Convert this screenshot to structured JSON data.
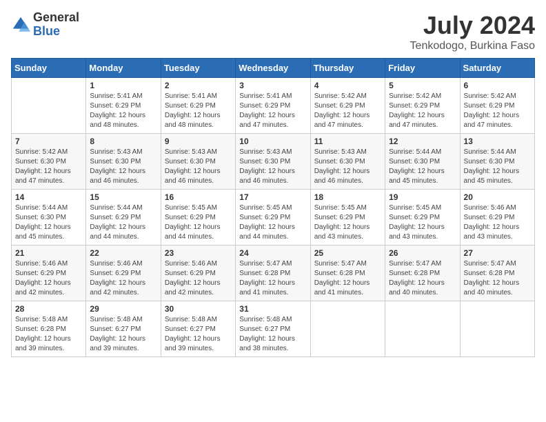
{
  "header": {
    "logo_general": "General",
    "logo_blue": "Blue",
    "title": "July 2024",
    "subtitle": "Tenkodogo, Burkina Faso"
  },
  "days_of_week": [
    "Sunday",
    "Monday",
    "Tuesday",
    "Wednesday",
    "Thursday",
    "Friday",
    "Saturday"
  ],
  "weeks": [
    [
      {
        "day": "",
        "info": ""
      },
      {
        "day": "1",
        "info": "Sunrise: 5:41 AM\nSunset: 6:29 PM\nDaylight: 12 hours\nand 48 minutes."
      },
      {
        "day": "2",
        "info": "Sunrise: 5:41 AM\nSunset: 6:29 PM\nDaylight: 12 hours\nand 48 minutes."
      },
      {
        "day": "3",
        "info": "Sunrise: 5:41 AM\nSunset: 6:29 PM\nDaylight: 12 hours\nand 47 minutes."
      },
      {
        "day": "4",
        "info": "Sunrise: 5:42 AM\nSunset: 6:29 PM\nDaylight: 12 hours\nand 47 minutes."
      },
      {
        "day": "5",
        "info": "Sunrise: 5:42 AM\nSunset: 6:29 PM\nDaylight: 12 hours\nand 47 minutes."
      },
      {
        "day": "6",
        "info": "Sunrise: 5:42 AM\nSunset: 6:29 PM\nDaylight: 12 hours\nand 47 minutes."
      }
    ],
    [
      {
        "day": "7",
        "info": "Sunrise: 5:42 AM\nSunset: 6:30 PM\nDaylight: 12 hours\nand 47 minutes."
      },
      {
        "day": "8",
        "info": "Sunrise: 5:43 AM\nSunset: 6:30 PM\nDaylight: 12 hours\nand 46 minutes."
      },
      {
        "day": "9",
        "info": "Sunrise: 5:43 AM\nSunset: 6:30 PM\nDaylight: 12 hours\nand 46 minutes."
      },
      {
        "day": "10",
        "info": "Sunrise: 5:43 AM\nSunset: 6:30 PM\nDaylight: 12 hours\nand 46 minutes."
      },
      {
        "day": "11",
        "info": "Sunrise: 5:43 AM\nSunset: 6:30 PM\nDaylight: 12 hours\nand 46 minutes."
      },
      {
        "day": "12",
        "info": "Sunrise: 5:44 AM\nSunset: 6:30 PM\nDaylight: 12 hours\nand 45 minutes."
      },
      {
        "day": "13",
        "info": "Sunrise: 5:44 AM\nSunset: 6:30 PM\nDaylight: 12 hours\nand 45 minutes."
      }
    ],
    [
      {
        "day": "14",
        "info": "Sunrise: 5:44 AM\nSunset: 6:30 PM\nDaylight: 12 hours\nand 45 minutes."
      },
      {
        "day": "15",
        "info": "Sunrise: 5:44 AM\nSunset: 6:29 PM\nDaylight: 12 hours\nand 44 minutes."
      },
      {
        "day": "16",
        "info": "Sunrise: 5:45 AM\nSunset: 6:29 PM\nDaylight: 12 hours\nand 44 minutes."
      },
      {
        "day": "17",
        "info": "Sunrise: 5:45 AM\nSunset: 6:29 PM\nDaylight: 12 hours\nand 44 minutes."
      },
      {
        "day": "18",
        "info": "Sunrise: 5:45 AM\nSunset: 6:29 PM\nDaylight: 12 hours\nand 43 minutes."
      },
      {
        "day": "19",
        "info": "Sunrise: 5:45 AM\nSunset: 6:29 PM\nDaylight: 12 hours\nand 43 minutes."
      },
      {
        "day": "20",
        "info": "Sunrise: 5:46 AM\nSunset: 6:29 PM\nDaylight: 12 hours\nand 43 minutes."
      }
    ],
    [
      {
        "day": "21",
        "info": "Sunrise: 5:46 AM\nSunset: 6:29 PM\nDaylight: 12 hours\nand 42 minutes."
      },
      {
        "day": "22",
        "info": "Sunrise: 5:46 AM\nSunset: 6:29 PM\nDaylight: 12 hours\nand 42 minutes."
      },
      {
        "day": "23",
        "info": "Sunrise: 5:46 AM\nSunset: 6:29 PM\nDaylight: 12 hours\nand 42 minutes."
      },
      {
        "day": "24",
        "info": "Sunrise: 5:47 AM\nSunset: 6:28 PM\nDaylight: 12 hours\nand 41 minutes."
      },
      {
        "day": "25",
        "info": "Sunrise: 5:47 AM\nSunset: 6:28 PM\nDaylight: 12 hours\nand 41 minutes."
      },
      {
        "day": "26",
        "info": "Sunrise: 5:47 AM\nSunset: 6:28 PM\nDaylight: 12 hours\nand 40 minutes."
      },
      {
        "day": "27",
        "info": "Sunrise: 5:47 AM\nSunset: 6:28 PM\nDaylight: 12 hours\nand 40 minutes."
      }
    ],
    [
      {
        "day": "28",
        "info": "Sunrise: 5:48 AM\nSunset: 6:28 PM\nDaylight: 12 hours\nand 39 minutes."
      },
      {
        "day": "29",
        "info": "Sunrise: 5:48 AM\nSunset: 6:27 PM\nDaylight: 12 hours\nand 39 minutes."
      },
      {
        "day": "30",
        "info": "Sunrise: 5:48 AM\nSunset: 6:27 PM\nDaylight: 12 hours\nand 39 minutes."
      },
      {
        "day": "31",
        "info": "Sunrise: 5:48 AM\nSunset: 6:27 PM\nDaylight: 12 hours\nand 38 minutes."
      },
      {
        "day": "",
        "info": ""
      },
      {
        "day": "",
        "info": ""
      },
      {
        "day": "",
        "info": ""
      }
    ]
  ]
}
